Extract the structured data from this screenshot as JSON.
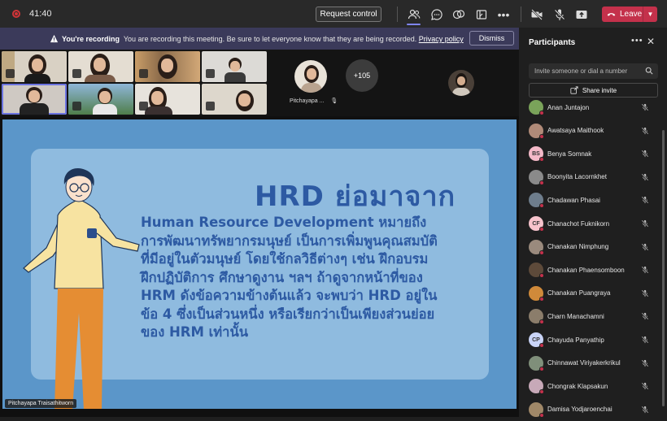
{
  "topbar": {
    "timer": "41:40",
    "request_control_label": "Request control",
    "leave_label": "Leave",
    "icons": [
      "people-icon",
      "chat-icon",
      "reactions-icon",
      "rooms-icon",
      "more-icon",
      "camera-off-icon",
      "mic-off-icon",
      "share-icon"
    ]
  },
  "banner": {
    "strong": "You're recording",
    "message": "You are recording this meeting. Be sure to let everyone know that they are being recorded.",
    "link": "Privacy policy",
    "dismiss_label": "Dismiss"
  },
  "strip": {
    "featured_name": "Pitchayapa ...",
    "more_count": "+105"
  },
  "slide": {
    "title": "HRD ย่อมาจาก",
    "lines": [
      "Human Resource Development หมายถึง",
      "การพัฒนาทรัพยากรมนุษย์  เป็นการเพิ่มพูนคุณสมบัติ",
      "ที่มีอยู่ในตัวมนุษย์  โดยใช้กลวิธีต่างๆ  เช่น  ฝึกอบรม",
      "ฝึกปฏิบัติการ  ศึกษาดูงาน  ฯลฯ  ถ้าดูจากหน้าที่ของ",
      "HRM ดังข้อความข้างต้นแล้ว จะพบว่า HRD อยู่ใน",
      "ข้อ 4  ซึ่งเป็นส่วนหนึ่ง  หรือเรียกว่าเป็นเพียงส่วนย่อย",
      "ของ HRM เท่านั้น"
    ],
    "speaker_name": "Pitchayapa Traisathitworn"
  },
  "panel": {
    "title": "Participants",
    "invite_placeholder": "Invite someone or dial a number",
    "share_invite_label": "Share invite",
    "participants": [
      {
        "name": "Anan Juntajon",
        "initials": "",
        "color": "#7aa35a"
      },
      {
        "name": "Awatsaya Maithook",
        "initials": "",
        "color": "#b08a78"
      },
      {
        "name": "Benya Somnak",
        "initials": "BS",
        "color": "#f4b9c8"
      },
      {
        "name": "Boonyita Lacornkhet",
        "initials": "",
        "color": "#8a8a8a"
      },
      {
        "name": "Chadawan Phasai",
        "initials": "",
        "color": "#6e7d8c"
      },
      {
        "name": "Chanachot Fuknikorn",
        "initials": "CF",
        "color": "#f7c3cc"
      },
      {
        "name": "Chanakan Nimphung",
        "initials": "",
        "color": "#9a8a7d"
      },
      {
        "name": "Chanakan Phaensomboon",
        "initials": "",
        "color": "#5d4a3a"
      },
      {
        "name": "Chanakan Puangraya",
        "initials": "",
        "color": "#d08a3a"
      },
      {
        "name": "Charn Manachamni",
        "initials": "",
        "color": "#8b7d6b"
      },
      {
        "name": "Chayuda Panyathip",
        "initials": "CP",
        "color": "#c9d4f7"
      },
      {
        "name": "Chinnawat Viriyakerkrikul",
        "initials": "",
        "color": "#7f8f7a"
      },
      {
        "name": "Chongrak Klapsakun",
        "initials": "",
        "color": "#c7a9b8"
      },
      {
        "name": "Damisa Yodjaroenchai",
        "initials": "",
        "color": "#a08868"
      }
    ]
  }
}
